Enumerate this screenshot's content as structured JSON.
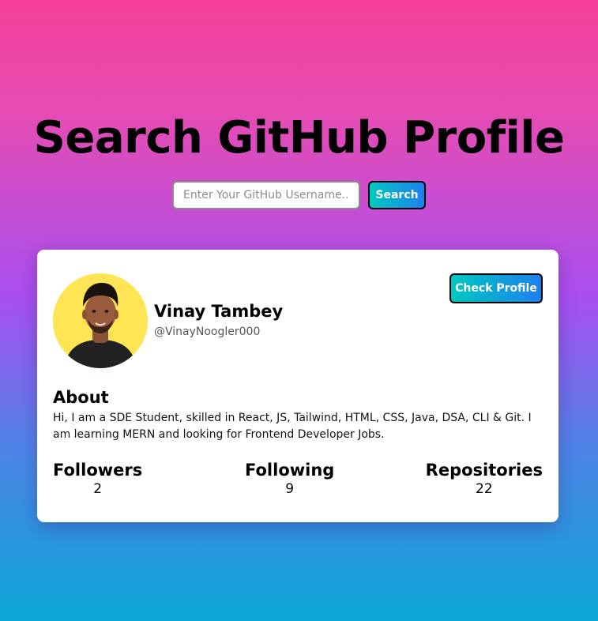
{
  "header": {
    "title": "Search GitHub Profile"
  },
  "search": {
    "placeholder": "Enter Your GitHub Username...",
    "value": "",
    "button_label": "Search"
  },
  "profile": {
    "name": "Vinay Tambey",
    "username": "@VinayNoogler000",
    "check_button_label": "Check Profile",
    "about_heading": "About",
    "about_text": "Hi, I am a SDE Student, skilled in React, JS, Tailwind, HTML, CSS, Java, DSA, CLI & Git. I am learning MERN and looking for Frontend Developer Jobs.",
    "stats": [
      {
        "label": "Followers",
        "value": "2"
      },
      {
        "label": "Following",
        "value": "9"
      },
      {
        "label": "Repositories",
        "value": "22"
      }
    ]
  },
  "colors": {
    "accent_start": "#00c9c0",
    "accent_end": "#1e7ff0",
    "avatar_bg": "#ffe553"
  }
}
